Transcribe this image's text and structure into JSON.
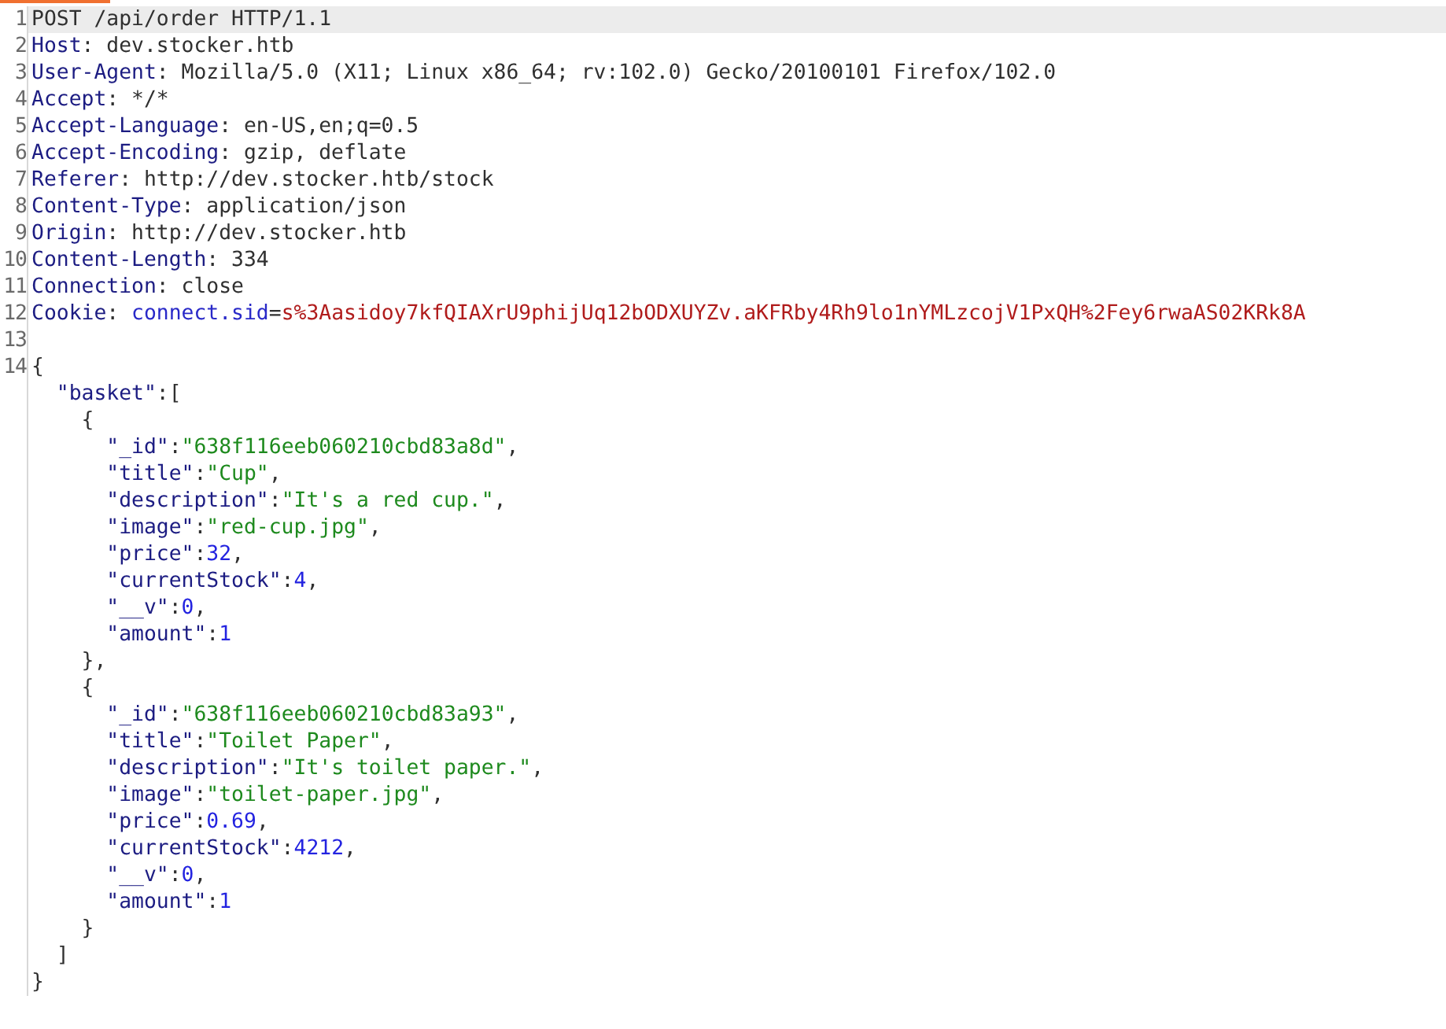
{
  "editor": {
    "lines": [
      {
        "number": "1",
        "current": true,
        "segments": [
          {
            "kind": "plain",
            "text": "POST /api/order HTTP/1.1"
          }
        ]
      },
      {
        "number": "2",
        "current": false,
        "segments": [
          {
            "kind": "header",
            "text": "Host"
          },
          {
            "kind": "plain",
            "text": ": dev.stocker.htb"
          }
        ]
      },
      {
        "number": "3",
        "current": false,
        "segments": [
          {
            "kind": "header",
            "text": "User-Agent"
          },
          {
            "kind": "plain",
            "text": ": Mozilla/5.0 (X11; Linux x86_64; rv:102.0) Gecko/20100101 Firefox/102.0"
          }
        ]
      },
      {
        "number": "4",
        "current": false,
        "segments": [
          {
            "kind": "header",
            "text": "Accept"
          },
          {
            "kind": "plain",
            "text": ": */*"
          }
        ]
      },
      {
        "number": "5",
        "current": false,
        "segments": [
          {
            "kind": "header",
            "text": "Accept-Language"
          },
          {
            "kind": "plain",
            "text": ": en-US,en;q=0.5"
          }
        ]
      },
      {
        "number": "6",
        "current": false,
        "segments": [
          {
            "kind": "header",
            "text": "Accept-Encoding"
          },
          {
            "kind": "plain",
            "text": ": gzip, deflate"
          }
        ]
      },
      {
        "number": "7",
        "current": false,
        "segments": [
          {
            "kind": "header",
            "text": "Referer"
          },
          {
            "kind": "plain",
            "text": ": http://dev.stocker.htb/stock"
          }
        ]
      },
      {
        "number": "8",
        "current": false,
        "segments": [
          {
            "kind": "header",
            "text": "Content-Type"
          },
          {
            "kind": "plain",
            "text": ": application/json"
          }
        ]
      },
      {
        "number": "9",
        "current": false,
        "segments": [
          {
            "kind": "header",
            "text": "Origin"
          },
          {
            "kind": "plain",
            "text": ": http://dev.stocker.htb"
          }
        ]
      },
      {
        "number": "10",
        "current": false,
        "segments": [
          {
            "kind": "header",
            "text": "Content-Length"
          },
          {
            "kind": "plain",
            "text": ": 334"
          }
        ]
      },
      {
        "number": "11",
        "current": false,
        "segments": [
          {
            "kind": "header",
            "text": "Connection"
          },
          {
            "kind": "plain",
            "text": ": close"
          }
        ]
      },
      {
        "number": "12",
        "current": false,
        "segments": [
          {
            "kind": "header",
            "text": "Cookie"
          },
          {
            "kind": "plain",
            "text": ": "
          },
          {
            "kind": "param",
            "text": "connect.sid"
          },
          {
            "kind": "plain",
            "text": "="
          },
          {
            "kind": "cookie",
            "text": "s%3Aasidoy7kfQIAXrU9phijUq12bODXUYZv.aKFRby4Rh9lo1nYMLzcojV1PxQH%2Fey6rwaAS02KRk8A"
          }
        ]
      },
      {
        "number": "13",
        "current": false
      },
      {
        "number": "14",
        "current": false,
        "segments": [
          {
            "kind": "plain",
            "text": "{"
          }
        ]
      },
      {
        "current": false,
        "segments": [
          {
            "kind": "key",
            "text": "  \"basket\""
          },
          {
            "kind": "plain",
            "text": ":["
          }
        ]
      },
      {
        "current": false,
        "segments": [
          {
            "kind": "plain",
            "text": "    {"
          }
        ]
      },
      {
        "current": false,
        "segments": [
          {
            "kind": "key",
            "text": "      \"_id\""
          },
          {
            "kind": "plain",
            "text": ":"
          },
          {
            "kind": "string",
            "text": "\"638f116eeb060210cbd83a8d\""
          },
          {
            "kind": "plain",
            "text": ","
          }
        ]
      },
      {
        "current": false,
        "segments": [
          {
            "kind": "key",
            "text": "      \"title\""
          },
          {
            "kind": "plain",
            "text": ":"
          },
          {
            "kind": "string",
            "text": "\"Cup\""
          },
          {
            "kind": "plain",
            "text": ","
          }
        ]
      },
      {
        "current": false,
        "segments": [
          {
            "kind": "key",
            "text": "      \"description\""
          },
          {
            "kind": "plain",
            "text": ":"
          },
          {
            "kind": "string",
            "text": "\"It's a red cup.\""
          },
          {
            "kind": "plain",
            "text": ","
          }
        ]
      },
      {
        "current": false,
        "segments": [
          {
            "kind": "key",
            "text": "      \"image\""
          },
          {
            "kind": "plain",
            "text": ":"
          },
          {
            "kind": "string",
            "text": "\"red-cup.jpg\""
          },
          {
            "kind": "plain",
            "text": ","
          }
        ]
      },
      {
        "current": false,
        "segments": [
          {
            "kind": "key",
            "text": "      \"price\""
          },
          {
            "kind": "plain",
            "text": ":"
          },
          {
            "kind": "number",
            "text": "32"
          },
          {
            "kind": "plain",
            "text": ","
          }
        ]
      },
      {
        "current": false,
        "segments": [
          {
            "kind": "key",
            "text": "      \"currentStock\""
          },
          {
            "kind": "plain",
            "text": ":"
          },
          {
            "kind": "number",
            "text": "4"
          },
          {
            "kind": "plain",
            "text": ","
          }
        ]
      },
      {
        "current": false,
        "segments": [
          {
            "kind": "key",
            "text": "      \"__v\""
          },
          {
            "kind": "plain",
            "text": ":"
          },
          {
            "kind": "number",
            "text": "0"
          },
          {
            "kind": "plain",
            "text": ","
          }
        ]
      },
      {
        "current": false,
        "segments": [
          {
            "kind": "key",
            "text": "      \"amount\""
          },
          {
            "kind": "plain",
            "text": ":"
          },
          {
            "kind": "number",
            "text": "1"
          }
        ]
      },
      {
        "current": false,
        "segments": [
          {
            "kind": "plain",
            "text": "    },"
          }
        ]
      },
      {
        "current": false,
        "segments": [
          {
            "kind": "plain",
            "text": "    {"
          }
        ]
      },
      {
        "current": false,
        "segments": [
          {
            "kind": "key",
            "text": "      \"_id\""
          },
          {
            "kind": "plain",
            "text": ":"
          },
          {
            "kind": "string",
            "text": "\"638f116eeb060210cbd83a93\""
          },
          {
            "kind": "plain",
            "text": ","
          }
        ]
      },
      {
        "current": false,
        "segments": [
          {
            "kind": "key",
            "text": "      \"title\""
          },
          {
            "kind": "plain",
            "text": ":"
          },
          {
            "kind": "string",
            "text": "\"Toilet Paper\""
          },
          {
            "kind": "plain",
            "text": ","
          }
        ]
      },
      {
        "current": false,
        "segments": [
          {
            "kind": "key",
            "text": "      \"description\""
          },
          {
            "kind": "plain",
            "text": ":"
          },
          {
            "kind": "string",
            "text": "\"It's toilet paper.\""
          },
          {
            "kind": "plain",
            "text": ","
          }
        ]
      },
      {
        "current": false,
        "segments": [
          {
            "kind": "key",
            "text": "      \"image\""
          },
          {
            "kind": "plain",
            "text": ":"
          },
          {
            "kind": "string",
            "text": "\"toilet-paper.jpg\""
          },
          {
            "kind": "plain",
            "text": ","
          }
        ]
      },
      {
        "current": false,
        "segments": [
          {
            "kind": "key",
            "text": "      \"price\""
          },
          {
            "kind": "plain",
            "text": ":"
          },
          {
            "kind": "number",
            "text": "0.69"
          },
          {
            "kind": "plain",
            "text": ","
          }
        ]
      },
      {
        "current": false,
        "segments": [
          {
            "kind": "key",
            "text": "      \"currentStock\""
          },
          {
            "kind": "plain",
            "text": ":"
          },
          {
            "kind": "number",
            "text": "4212"
          },
          {
            "kind": "plain",
            "text": ","
          }
        ]
      },
      {
        "current": false,
        "segments": [
          {
            "kind": "key",
            "text": "      \"__v\""
          },
          {
            "kind": "plain",
            "text": ":"
          },
          {
            "kind": "number",
            "text": "0"
          },
          {
            "kind": "plain",
            "text": ","
          }
        ]
      },
      {
        "current": false,
        "segments": [
          {
            "kind": "key",
            "text": "      \"amount\""
          },
          {
            "kind": "plain",
            "text": ":"
          },
          {
            "kind": "number",
            "text": "1"
          }
        ]
      },
      {
        "current": false,
        "segments": [
          {
            "kind": "plain",
            "text": "    }"
          }
        ]
      },
      {
        "current": false,
        "segments": [
          {
            "kind": "plain",
            "text": "  ]"
          }
        ]
      },
      {
        "current": false,
        "segments": [
          {
            "kind": "plain",
            "text": "}"
          }
        ]
      }
    ]
  }
}
